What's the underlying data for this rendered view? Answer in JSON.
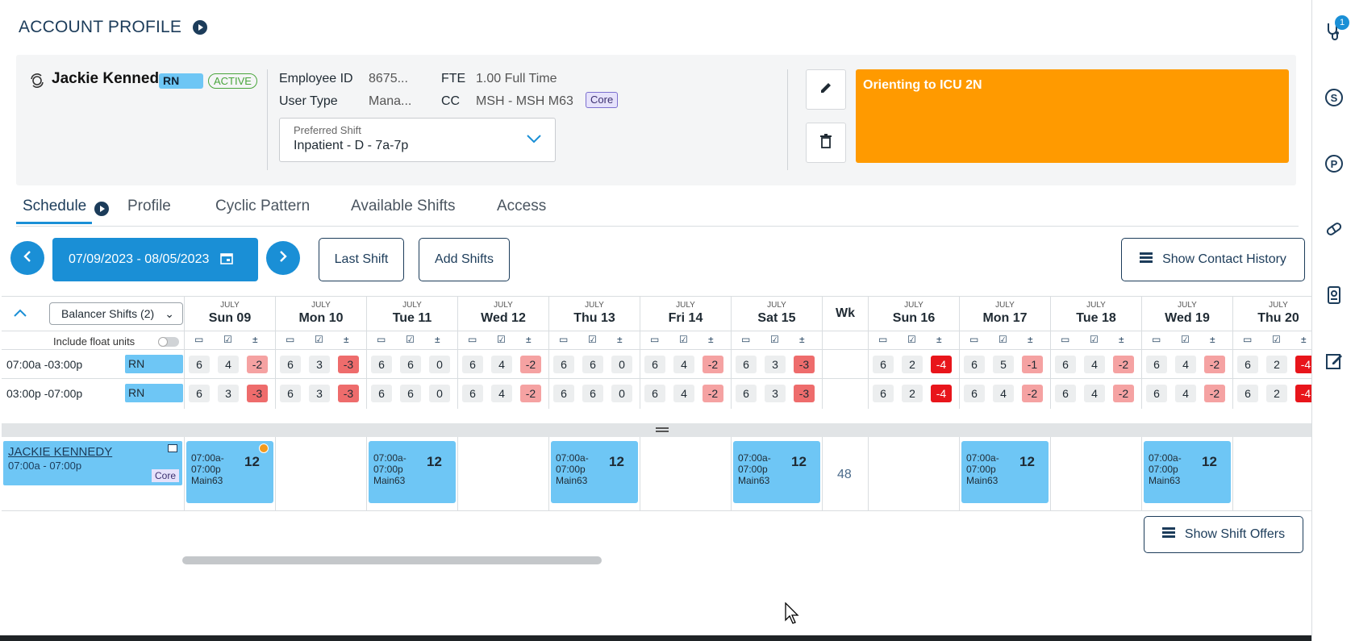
{
  "header": {
    "title": "ACCOUNT PROFILE"
  },
  "employee": {
    "name": "Jackie Kennedy",
    "role": "RN",
    "status": "ACTIVE",
    "employee_id_label": "Employee ID",
    "employee_id": "8675...",
    "user_type_label": "User Type",
    "user_type": "Mana...",
    "fte_label": "FTE",
    "fte": "1.00 Full Time",
    "cc_label": "CC",
    "cc": "MSH - MSH M63",
    "cc_badge": "Core",
    "preferred_shift_label": "Preferred Shift",
    "preferred_shift": "Inpatient - D - 7a-7p",
    "note": "Orienting to ICU 2N",
    "note_color": "#ff9a00"
  },
  "tabs": [
    "Schedule",
    "Profile",
    "Cyclic Pattern",
    "Available Shifts",
    "Access"
  ],
  "toolbar": {
    "date_range": "07/09/2023 - 08/05/2023",
    "last_shift": "Last Shift",
    "add_shifts": "Add Shifts",
    "show_contact_history": "Show Contact History"
  },
  "grid": {
    "balancer_label": "Balancer Shifts (2)",
    "float_label": "Include float units",
    "wk_label": "Wk",
    "days": [
      {
        "month": "JULY",
        "label": "Sun 09"
      },
      {
        "month": "JULY",
        "label": "Mon 10"
      },
      {
        "month": "JULY",
        "label": "Tue 11"
      },
      {
        "month": "JULY",
        "label": "Wed 12"
      },
      {
        "month": "JULY",
        "label": "Thu 13"
      },
      {
        "month": "JULY",
        "label": "Fri 14"
      },
      {
        "month": "JULY",
        "label": "Sat 15"
      },
      {
        "month": "JULY",
        "label": "Sun 16"
      },
      {
        "month": "JULY",
        "label": "Mon 17"
      },
      {
        "month": "JULY",
        "label": "Tue 18"
      },
      {
        "month": "JULY",
        "label": "Wed 19"
      },
      {
        "month": "JULY",
        "label": "Thu 20"
      }
    ],
    "rows": [
      {
        "time": "07:00a -03:00p",
        "role": "RN",
        "cells": [
          [
            "6",
            "4",
            "-2"
          ],
          [
            "6",
            "3",
            "-3"
          ],
          [
            "6",
            "6",
            "0"
          ],
          [
            "6",
            "4",
            "-2"
          ],
          [
            "6",
            "6",
            "0"
          ],
          [
            "6",
            "4",
            "-2"
          ],
          [
            "6",
            "3",
            "-3"
          ],
          [
            "6",
            "2",
            "-4"
          ],
          [
            "6",
            "5",
            "-1"
          ],
          [
            "6",
            "4",
            "-2"
          ],
          [
            "6",
            "4",
            "-2"
          ],
          [
            "6",
            "2",
            "-4"
          ]
        ]
      },
      {
        "time": "03:00p -07:00p",
        "role": "RN",
        "cells": [
          [
            "6",
            "3",
            "-3"
          ],
          [
            "6",
            "3",
            "-3"
          ],
          [
            "6",
            "6",
            "0"
          ],
          [
            "6",
            "4",
            "-2"
          ],
          [
            "6",
            "6",
            "0"
          ],
          [
            "6",
            "4",
            "-2"
          ],
          [
            "6",
            "3",
            "-3"
          ],
          [
            "6",
            "2",
            "-4"
          ],
          [
            "6",
            "4",
            "-2"
          ],
          [
            "6",
            "4",
            "-2"
          ],
          [
            "6",
            "4",
            "-2"
          ],
          [
            "6",
            "2",
            "-4"
          ]
        ]
      }
    ]
  },
  "schedule": {
    "person_name": "JACKIE KENNEDY",
    "person_hours": "07:00a - 07:00p",
    "person_badge": "Core",
    "week_total": "48",
    "shift_time_line1": "07:00a-",
    "shift_time_line2": "07:00p",
    "shift_unit": "Main63",
    "shift_hours": "12",
    "shift_days": [
      0,
      2,
      4,
      6,
      8,
      10
    ]
  },
  "show_shift_offers": "Show Shift Offers",
  "notification_count": "1",
  "side_icons": [
    "stethoscope-icon",
    "s-circle-icon",
    "p-circle-icon",
    "pill-icon",
    "badge-icon",
    "edit-note-icon"
  ]
}
